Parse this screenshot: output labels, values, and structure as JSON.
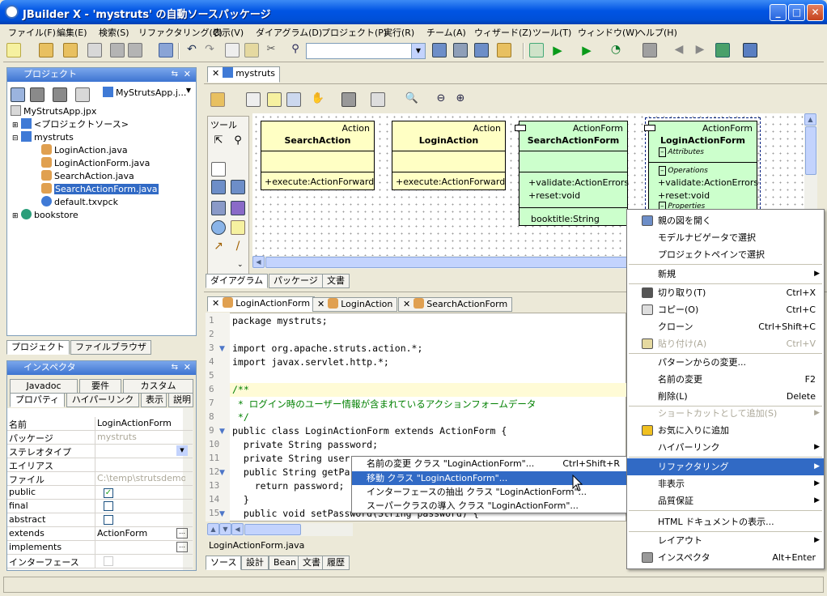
{
  "window": {
    "title": "JBuilder X - 'mystruts' の自動ソースパッケージ"
  },
  "menu": [
    "ファイル(F)",
    "編集(E)",
    "検索(S)",
    "リファクタリング(C)",
    "表示(V)",
    "ダイアグラム(D)",
    "プロジェクト(P)",
    "実行(R)",
    "チーム(A)",
    "ウィザード(Z)",
    "ツール(T)",
    "ウィンドウ(W)",
    "ヘルプ(H)"
  ],
  "project_panel": {
    "title": "プロジェクト",
    "project_combo": "MyStrutsApp.j...",
    "tree": [
      "MyStrutsApp.jpx",
      "<プロジェクトソース>",
      "mystruts",
      "LoginAction.java",
      "LoginActionForm.java",
      "SearchAction.java",
      "SearchActionForm.java",
      "default.txvpck",
      "bookstore"
    ],
    "tabs": [
      "プロジェクト",
      "ファイルブラウザ"
    ]
  },
  "inspector": {
    "title": "インスペクタ",
    "tabs_top": [
      "Javadoc",
      "要件",
      "カスタム"
    ],
    "tabs_bottom": [
      "プロパティ",
      "ハイパーリンク",
      "表示",
      "説明"
    ],
    "rows": [
      {
        "key": "名前",
        "value": "LoginActionForm"
      },
      {
        "key": "パッケージ",
        "value": "mystruts"
      },
      {
        "key": "ステレオタイプ",
        "value": ""
      },
      {
        "key": "エイリアス",
        "value": ""
      },
      {
        "key": "ファイル",
        "value": "C:\\temp\\strutsdemo..."
      },
      {
        "key": "public",
        "value": "✓"
      },
      {
        "key": "final",
        "value": ""
      },
      {
        "key": "abstract",
        "value": ""
      },
      {
        "key": "extends",
        "value": "ActionForm"
      },
      {
        "key": "implements",
        "value": ""
      },
      {
        "key": "インターフェース",
        "value": ""
      }
    ]
  },
  "diagram": {
    "file_tab": "mystruts",
    "palette_title": "ツール",
    "bottom_tabs": [
      "ダイアグラム",
      "パッケージ",
      "文書"
    ],
    "classes": [
      {
        "stereotype": "Action",
        "name": "SearchAction",
        "op": "+execute:ActionForward"
      },
      {
        "stereotype": "Action",
        "name": "LoginAction",
        "op": "+execute:ActionForward"
      },
      {
        "stereotype": "ActionForm",
        "name": "SearchActionForm",
        "ops": [
          "+validate:ActionErrors",
          "+reset:void"
        ],
        "attr": "booktitle:String"
      },
      {
        "stereotype": "ActionForm",
        "name": "LoginActionForm",
        "sections": [
          "Attributes",
          "Operations",
          "Properties"
        ],
        "ops": [
          "+validate:ActionErrors",
          "+reset:void"
        ]
      }
    ]
  },
  "editor": {
    "tabs": [
      "LoginActionForm",
      "LoginAction",
      "SearchActionForm"
    ],
    "lines": [
      {
        "n": "1",
        "t": "package mystruts;"
      },
      {
        "n": "2",
        "t": ""
      },
      {
        "n": "3",
        "t": "import org.apache.struts.action.*;"
      },
      {
        "n": "4",
        "t": "import javax.servlet.http.*;"
      },
      {
        "n": "5",
        "t": ""
      },
      {
        "n": "6",
        "t": "/**"
      },
      {
        "n": "7",
        "t": " * ログイン時のユーザー情報が含まれているアクションフォームデータ"
      },
      {
        "n": "8",
        "t": " */"
      },
      {
        "n": "9",
        "t": "public class LoginActionForm extends ActionForm {"
      },
      {
        "n": "10",
        "t": "  private String password;"
      },
      {
        "n": "11",
        "t": "  private String user"
      },
      {
        "n": "12",
        "t": "  public String getPa"
      },
      {
        "n": "13",
        "t": "    return password;"
      },
      {
        "n": "14",
        "t": "  }"
      },
      {
        "n": "15",
        "t": "  public void setPassword(String password) {"
      }
    ],
    "status_file": "LoginActionForm.java",
    "bottom_tabs": [
      "ソース",
      "設計",
      "Bean",
      "文書",
      "履歴"
    ]
  },
  "context_menu": [
    {
      "label": "親の図を開く",
      "shortcut": "",
      "icon": "diagram-icon"
    },
    {
      "label": "モデルナビゲータで選択",
      "shortcut": ""
    },
    {
      "label": "プロジェクトペインで選択",
      "shortcut": ""
    },
    {
      "label": "新規",
      "shortcut": "",
      "sub": true
    },
    {
      "label": "切り取り(T)",
      "shortcut": "Ctrl+X",
      "icon": "scissors-icon"
    },
    {
      "label": "コピー(O)",
      "shortcut": "Ctrl+C",
      "icon": "copy-icon"
    },
    {
      "label": "クローン",
      "shortcut": "Ctrl+Shift+C"
    },
    {
      "label": "貼り付け(A)",
      "shortcut": "Ctrl+V",
      "disabled": true,
      "icon": "paste-icon"
    },
    {
      "label": "パターンからの変更...",
      "shortcut": ""
    },
    {
      "label": "名前の変更",
      "shortcut": "F2"
    },
    {
      "label": "削除(L)",
      "shortcut": "Delete"
    },
    {
      "label": "ショートカットとして追加(S)",
      "shortcut": "",
      "disabled": true,
      "sub": true
    },
    {
      "label": "お気に入りに追加",
      "shortcut": "",
      "icon": "star-icon"
    },
    {
      "label": "ハイパーリンク",
      "shortcut": "",
      "sub": true
    },
    {
      "label": "リファクタリング",
      "shortcut": "",
      "sub": true,
      "selected": true
    },
    {
      "label": "非表示",
      "shortcut": "",
      "sub": true
    },
    {
      "label": "品質保証",
      "shortcut": "",
      "sub": true
    },
    {
      "label": "HTML ドキュメントの表示...",
      "shortcut": ""
    },
    {
      "label": "レイアウト",
      "shortcut": "",
      "sub": true
    },
    {
      "label": "インスペクタ",
      "shortcut": "Alt+Enter",
      "icon": "hand-icon"
    }
  ],
  "refactor_submenu": [
    {
      "label": "名前の変更 クラス \"LoginActionForm\"...",
      "shortcut": "Ctrl+Shift+R"
    },
    {
      "label": "移動 クラス \"LoginActionForm\"...",
      "shortcut": "",
      "selected": true
    },
    {
      "label": "インターフェースの抽出 クラス \"LoginActionForm\"...",
      "shortcut": ""
    },
    {
      "label": "スーパークラスの導入 クラス \"LoginActionForm\"...",
      "shortcut": ""
    }
  ]
}
